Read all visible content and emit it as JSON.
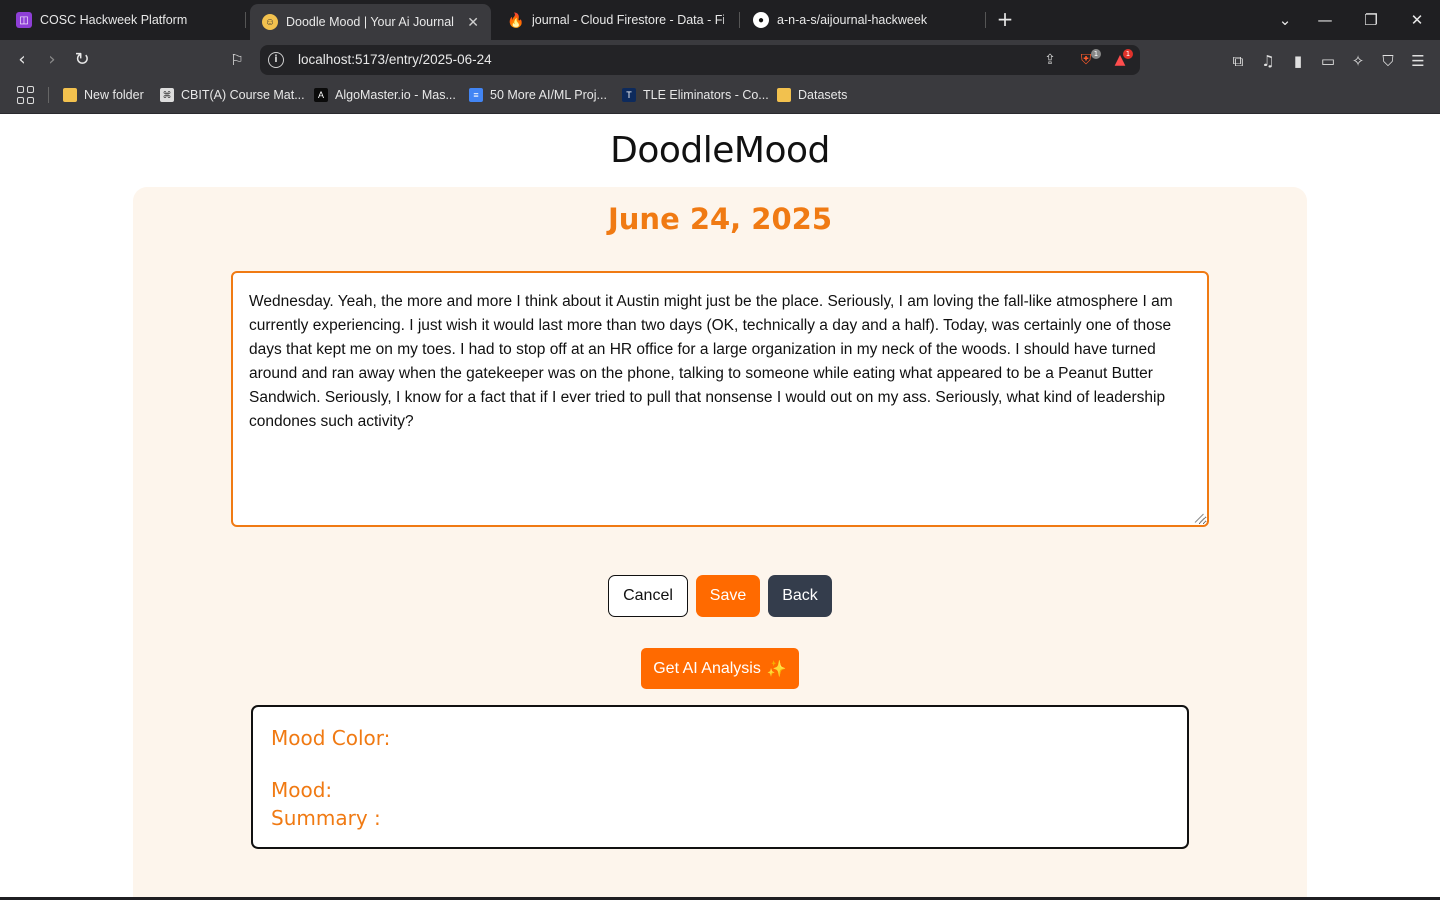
{
  "browser": {
    "tabs": [
      {
        "label": "COSC Hackweek Platform",
        "favicon": "cosc-logo-icon"
      },
      {
        "label": "Doodle Mood | Your Ai Journal",
        "favicon": "doodlemood-favicon-icon",
        "active": true
      },
      {
        "label": "journal - Cloud Firestore - Data - Fire",
        "favicon": "firebase-flame-icon"
      },
      {
        "label": "a-n-a-s/aijournal-hackweek",
        "favicon": "github-icon"
      }
    ],
    "url": "localhost:5173/entry/2025-06-24",
    "shields_badge": "1",
    "rewards_badge": "1",
    "bookmarks": [
      {
        "label": "New folder",
        "icon": "folder-icon"
      },
      {
        "label": "CBIT(A) Course Mat...",
        "icon": "cbit-icon"
      },
      {
        "label": "AlgoMaster.io - Mas...",
        "icon": "algomaster-icon"
      },
      {
        "label": "50 More AI/ML Proj...",
        "icon": "docs-icon"
      },
      {
        "label": "TLE Eliminators - Co...",
        "icon": "tle-icon"
      },
      {
        "label": "Datasets",
        "icon": "folder-icon"
      }
    ]
  },
  "app": {
    "title": "DoodleMood",
    "entry_date": "June 24, 2025",
    "entry_text": "Wednesday. Yeah, the more and more I think about it Austin might just be the place. Seriously, I am loving the fall-like atmosphere I am currently experiencing. I just wish it would last more than two days (OK, technically a day and a half). Today, was certainly one of those days that kept me on my toes. I had to stop off at an HR office for a large organization in my neck of the woods. I should have turned around and ran away when the gatekeeper was on the phone, talking to someone while eating what appeared to be a Peanut Butter Sandwich. Seriously, I know for a fact that if I ever tried to pull that nonsense I would out on my ass. Seriously, what kind of leadership condones such activity?",
    "buttons": {
      "cancel": "Cancel",
      "save": "Save",
      "back": "Back",
      "ai_analysis": "Get AI Analysis",
      "ai_sparkle": "✨"
    },
    "analysis": {
      "mood_color_label": "Mood Color:",
      "mood_label": "Mood:",
      "summary_label": "Summary :"
    }
  },
  "colors": {
    "accent_orange": "#ff6a00",
    "heading_orange": "#f07a13",
    "card_bg": "#fdf5ec",
    "back_button": "#343d4c"
  }
}
